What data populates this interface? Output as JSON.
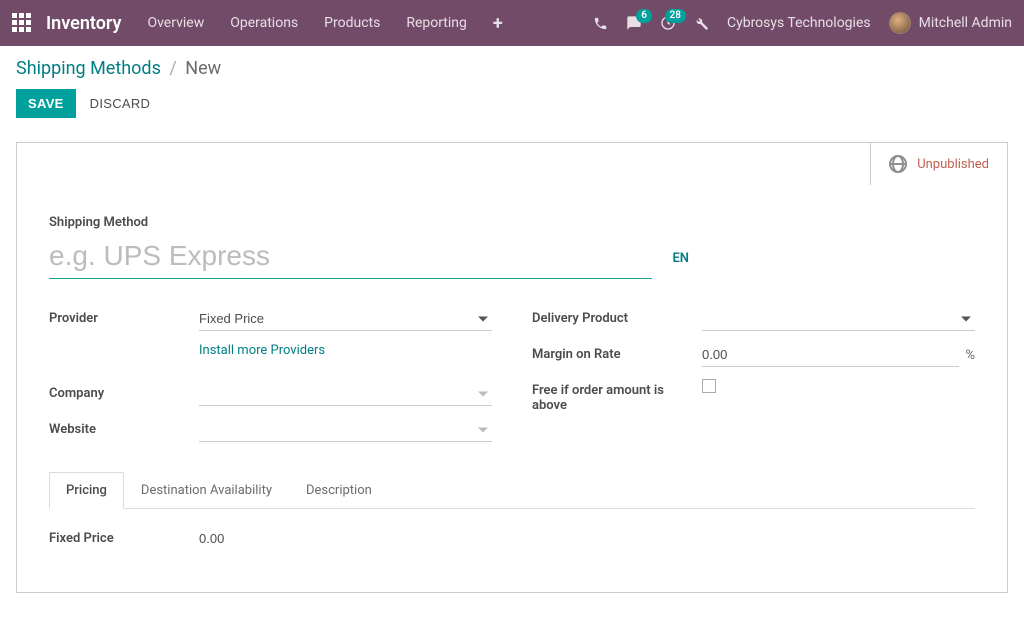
{
  "navbar": {
    "brand": "Inventory",
    "links": [
      "Overview",
      "Operations",
      "Products",
      "Reporting"
    ],
    "msg_badge": "6",
    "activity_badge": "28",
    "company": "Cybrosys Technologies",
    "user": "Mitchell Admin"
  },
  "breadcrumbs": {
    "parent": "Shipping Methods",
    "current": "New"
  },
  "buttons": {
    "save": "Save",
    "discard": "Discard"
  },
  "publish": {
    "label": "Unpublished"
  },
  "form": {
    "title_label": "Shipping Method",
    "title_placeholder": "e.g. UPS Express",
    "title_value": "",
    "lang": "EN",
    "left": {
      "provider_label": "Provider",
      "provider_value": "Fixed Price",
      "install_link": "Install more Providers",
      "company_label": "Company",
      "company_value": "",
      "website_label": "Website",
      "website_value": ""
    },
    "right": {
      "delivery_product_label": "Delivery Product",
      "delivery_product_value": "",
      "margin_label": "Margin on Rate",
      "margin_value": "0.00",
      "margin_unit": "%",
      "free_label": "Free if order amount is above",
      "free_checked": false
    }
  },
  "tabs": {
    "items": [
      "Pricing",
      "Destination Availability",
      "Description"
    ],
    "active": 0,
    "pricing": {
      "fixed_label": "Fixed Price",
      "fixed_value": "0.00"
    }
  }
}
